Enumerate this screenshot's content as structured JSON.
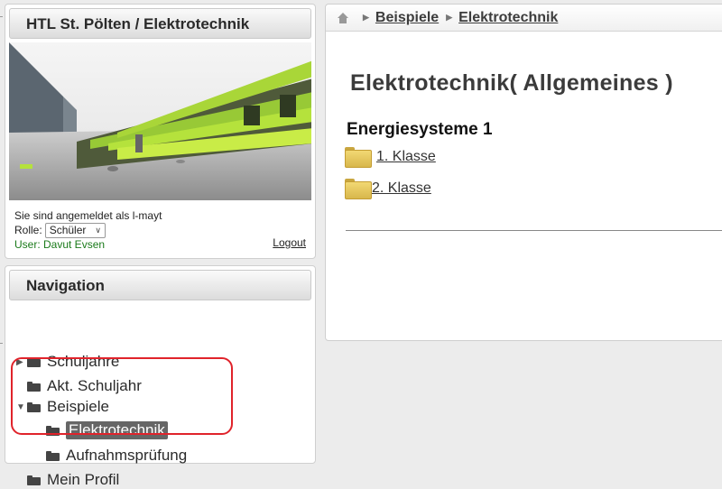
{
  "header": {
    "title": "HTL St. Pölten / Elektrotechnik",
    "logged_in_text": "Sie sind angemeldet als l-mayt",
    "role_label": "Rolle:",
    "role_selected": "Schüler",
    "user_line": "User: Davut Evsen",
    "logout": "Logout"
  },
  "navigation": {
    "title": "Navigation",
    "items": [
      {
        "label": "Schuljahre",
        "expandable": true,
        "expanded": false
      },
      {
        "label": "Akt. Schuljahr",
        "expandable": false
      },
      {
        "label": "Beispiele",
        "expandable": true,
        "expanded": true
      },
      {
        "label": "Elektrotechnik",
        "active": true
      },
      {
        "label": "Aufnahmsprüfung"
      },
      {
        "label": "Mein Profil"
      }
    ]
  },
  "breadcrumb": [
    "Beispiele",
    "Elektrotechnik"
  ],
  "main": {
    "title": "Elektrotechnik( Allgemeines )",
    "section": "Energiesysteme 1",
    "links": [
      "1. Klasse",
      "2. Klasse"
    ]
  },
  "colors": {
    "highlight": "#e0232b",
    "user_text": "#1a7a1a",
    "folder_yellow": "#f2d873"
  }
}
